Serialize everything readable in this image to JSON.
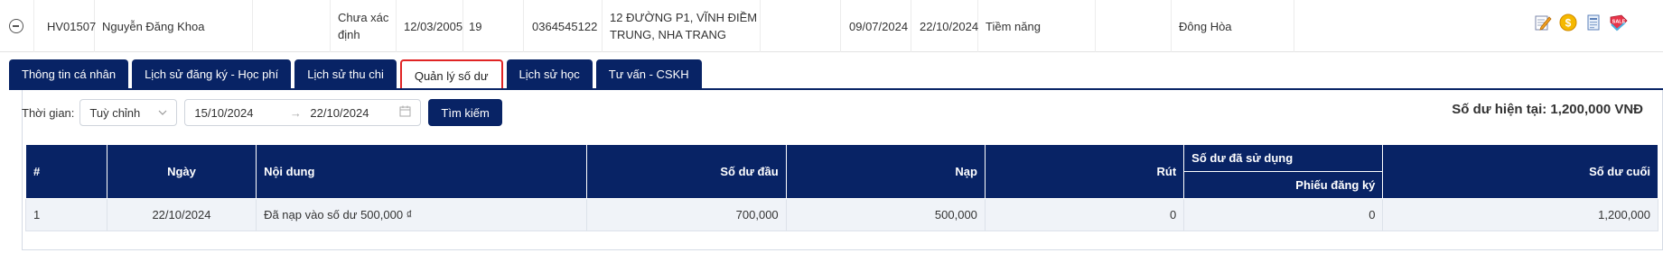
{
  "student": {
    "code": "HV01507",
    "name": "Nguyễn Đăng Khoa",
    "empty_col": "",
    "status": "Chưa xác định",
    "dob": "12/03/2005",
    "age": "19",
    "phone": "0364545122",
    "address": "12 ĐƯỜNG P1, VĨNH ĐIỀM TRUNG, NHA TRANG",
    "empty_col2": "",
    "date1": "09/07/2024",
    "date2": "22/10/2024",
    "type": "Tiềm năng",
    "empty_col3": "",
    "branch": "Đông Hòa"
  },
  "action_icons": [
    "edit-icon",
    "coin-icon",
    "document-icon",
    "sale-tag-icon"
  ],
  "tabs": [
    {
      "label": "Thông tin cá nhân",
      "active": false
    },
    {
      "label": "Lịch sử đăng ký - Học phí",
      "active": false
    },
    {
      "label": "Lịch sử thu chi",
      "active": false
    },
    {
      "label": "Quản lý số dư",
      "active": true
    },
    {
      "label": "Lịch sử học",
      "active": false
    },
    {
      "label": "Tư vấn - CSKH",
      "active": false
    }
  ],
  "filter": {
    "time_label": "Thời gian:",
    "select_value": "Tuỳ chỉnh",
    "date_from": "15/10/2024",
    "date_to": "22/10/2024",
    "search_label": "Tìm kiếm",
    "arrow": "→"
  },
  "balance_text": "Số dư hiện tại: 1,200,000 VNĐ",
  "table": {
    "headers": {
      "index": "#",
      "date": "Ngày",
      "content": "Nội dung",
      "opening": "Số dư đầu",
      "deposit": "Nạp",
      "withdraw": "Rút",
      "used_group": "Số dư đã sử dụng",
      "used_sub": "Phiếu đăng ký",
      "closing": "Số dư cuối"
    },
    "rows": [
      {
        "index": "1",
        "date": "22/10/2024",
        "content": "Đã nạp vào số dư 500,000 ₫",
        "opening": "700,000",
        "deposit": "500,000",
        "withdraw": "0",
        "used": "0",
        "closing": "1,200,000"
      }
    ]
  },
  "colors": {
    "navy": "#082365",
    "active_tab_border": "#e02424",
    "row_bg": "#f0f3f8"
  }
}
